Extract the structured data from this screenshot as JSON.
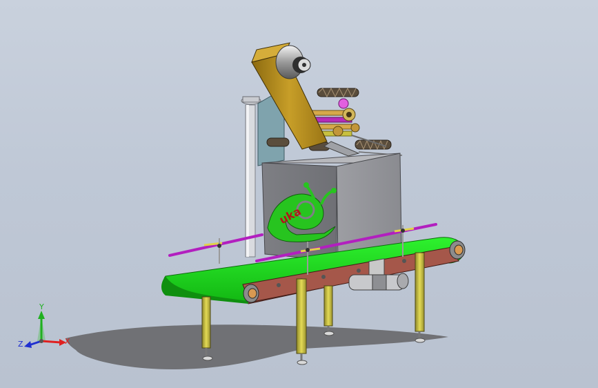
{
  "viewport": {
    "background_top": "#c9d1dd",
    "background_bottom": "#b9c2d0"
  },
  "model": {
    "logo_text": "uka",
    "colors": {
      "belt": "#1fe01f",
      "frame_rail": "#a5574a",
      "cabinet": "#8f9094",
      "legs": "#d9d04a",
      "label_arm": "#c9a02a",
      "guide_rails": "#b21fbf",
      "logo_green": "#27c41f"
    }
  },
  "triad": {
    "x_label": "X",
    "y_label": "Y",
    "z_label": "Z",
    "x_color": "#e02020",
    "y_color": "#20b020",
    "z_color": "#2030d0"
  }
}
